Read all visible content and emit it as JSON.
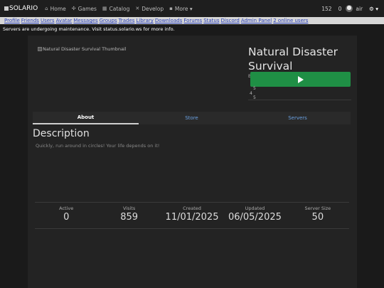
{
  "navbar": {
    "brand": "SOLARIO",
    "items": [
      {
        "icon": "home-icon",
        "glyph": "⌂",
        "label": "Home"
      },
      {
        "icon": "gamepad-icon",
        "glyph": "✣",
        "label": "Games"
      },
      {
        "icon": "store-icon",
        "glyph": "▦",
        "label": "Catalog"
      },
      {
        "icon": "tools-icon",
        "glyph": "✕",
        "label": "Develop"
      },
      {
        "icon": "grid-icon",
        "glyph": "▪",
        "label": "More ▾"
      }
    ],
    "currency_a": "152",
    "currency_b": "0",
    "username": "air",
    "settings": "⚙ ▾"
  },
  "linkbar": {
    "links": [
      "Profile",
      "Friends",
      "Users",
      "Avatar",
      "Messages",
      "Groups",
      "Trades",
      "Library",
      "Downloads",
      "Forums",
      "Status",
      "Discord",
      "Admin Panel",
      "2 online users"
    ]
  },
  "maintenance": "Servers are undergoing maintenance. Visit status.solario.ws for more info.",
  "game": {
    "thumbnail_alt": "Natural Disaster Survival Thumbnail",
    "title": "Natural Disaster Survival",
    "side_letter": "B",
    "rating_lines": [
      "5",
      "4",
      "5"
    ]
  },
  "tabs": [
    {
      "label": "About"
    },
    {
      "label": "Store"
    },
    {
      "label": "Servers"
    }
  ],
  "description": {
    "heading": "Description",
    "text": "Quickly, run around in circles! Your life depends on it!"
  },
  "stats": [
    {
      "label": "Active",
      "value": "0"
    },
    {
      "label": "Visits",
      "value": "859"
    },
    {
      "label": "Created",
      "value": "11/01/2025"
    },
    {
      "label": "Updated",
      "value": "06/05/2025"
    },
    {
      "label": "Server Size",
      "value": "50"
    }
  ],
  "colors": {
    "play_button": "#1f8f45",
    "link": "#2a40b8",
    "tab_link": "#6aa0e0"
  }
}
